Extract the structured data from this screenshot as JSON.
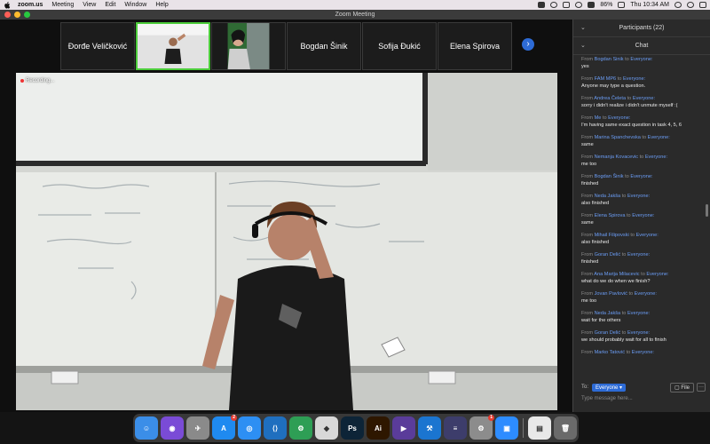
{
  "menubar": {
    "app": "zoom.us",
    "items": [
      "Meeting",
      "View",
      "Edit",
      "Window",
      "Help"
    ],
    "battery": "86%",
    "clock": "Thu 10:34 AM"
  },
  "window": {
    "title": "Zoom Meeting"
  },
  "strip": {
    "tiles": [
      "Đorđe Veličković",
      "",
      "",
      "Bogdan Šinik",
      "Sofija Đukić",
      "Elena Spirova"
    ],
    "next_label": "›"
  },
  "main_video": {
    "recording_label": "Recording..."
  },
  "panel": {
    "participants_label": "Participants (22)",
    "chat_label": "Chat",
    "from_word": "From",
    "to_word": "to",
    "messages": [
      {
        "from": "Bogdan Šinik",
        "to": "Everyone:",
        "text": "yes"
      },
      {
        "from": "FAM MP6",
        "to": "Everyone:",
        "text": "Anyone may type a question."
      },
      {
        "from": "Andrea Čeleta",
        "to": "Everyone:",
        "text": "sorry i didn't realize i didn't unmute myself :("
      },
      {
        "from": "Me",
        "to": "Everyone:",
        "text": "I'm having same exact question in task 4, 5, 6"
      },
      {
        "from": "Marina Spanchevska",
        "to": "Everyone:",
        "text": "same"
      },
      {
        "from": "Nemanja Kovacevic",
        "to": "Everyone:",
        "text": "me too"
      },
      {
        "from": "Bogdan Šinik",
        "to": "Everyone:",
        "text": "finished"
      },
      {
        "from": "Neda Jakša",
        "to": "Everyone:",
        "text": "also finished"
      },
      {
        "from": "Elena Spirova",
        "to": "Everyone:",
        "text": "same"
      },
      {
        "from": "Mihail Filipovski",
        "to": "Everyone:",
        "text": "also finished"
      },
      {
        "from": "Goran Delić",
        "to": "Everyone:",
        "text": "finished"
      },
      {
        "from": "Ana Marija Milacevic",
        "to": "Everyone:",
        "text": "what do we do when we finish?"
      },
      {
        "from": "Jovan Pavlović",
        "to": "Everyone:",
        "text": "me too"
      },
      {
        "from": "Neda Jakša",
        "to": "Everyone:",
        "text": "wait for the others"
      },
      {
        "from": "Goran Delić",
        "to": "Everyone:",
        "text": "we should probably wait for all to finish"
      },
      {
        "from": "Marko Tatović",
        "to": "Everyone:",
        "text": ""
      }
    ],
    "to_label": "To:",
    "to_value": "Everyone",
    "file_label": "File",
    "more_label": "···",
    "input_placeholder": "Type message here..."
  },
  "dock": {
    "apps": [
      {
        "name": "Finder",
        "icon": "finder-icon",
        "color": "#3b8ee8",
        "glyph": "☺"
      },
      {
        "name": "Siri",
        "icon": "siri-icon",
        "color": "#7a4bd6",
        "glyph": "◉"
      },
      {
        "name": "Launchpad",
        "icon": "launchpad-icon",
        "color": "#8a8a8a",
        "glyph": "✈"
      },
      {
        "name": "App Store",
        "icon": "app-store-icon",
        "color": "#1f8af0",
        "glyph": "A",
        "badge": "2"
      },
      {
        "name": "Safari",
        "icon": "safari-icon",
        "color": "#2d8ff3",
        "glyph": "◎"
      },
      {
        "name": "VS Code",
        "icon": "vscode-icon",
        "color": "#1f6fbf",
        "glyph": "⟨⟩"
      },
      {
        "name": "Android Studio",
        "icon": "android-studio-icon",
        "color": "#2e9e55",
        "glyph": "⚙"
      },
      {
        "name": "Inkscape",
        "icon": "inkscape-icon",
        "color": "#d8d8d8",
        "glyph": "◆"
      },
      {
        "name": "Photoshop",
        "icon": "photoshop-icon",
        "color": "#0d2437",
        "glyph": "Ps"
      },
      {
        "name": "Illustrator",
        "icon": "illustrator-icon",
        "color": "#2e1700",
        "glyph": "Ai"
      },
      {
        "name": "Final Cut",
        "icon": "final-cut-icon",
        "color": "#5a3c9a",
        "glyph": "▶"
      },
      {
        "name": "Xcode",
        "icon": "xcode-icon",
        "color": "#1b75d0",
        "glyph": "⚒"
      },
      {
        "name": "Blender",
        "icon": "blender-icon",
        "color": "#3d3d6b",
        "glyph": "≡"
      },
      {
        "name": "System Preferences",
        "icon": "system-preferences-icon",
        "color": "#8c8c8c",
        "glyph": "⚙",
        "badge": "1"
      },
      {
        "name": "Zoom",
        "icon": "zoom-icon",
        "color": "#2d8cff",
        "glyph": "▣"
      },
      {
        "name": "Document",
        "icon": "document-icon",
        "color": "#e8e8e8",
        "glyph": "▤"
      },
      {
        "name": "Trash",
        "icon": "trash-icon",
        "color": "#6a6a6a",
        "glyph": "🗑"
      }
    ]
  }
}
